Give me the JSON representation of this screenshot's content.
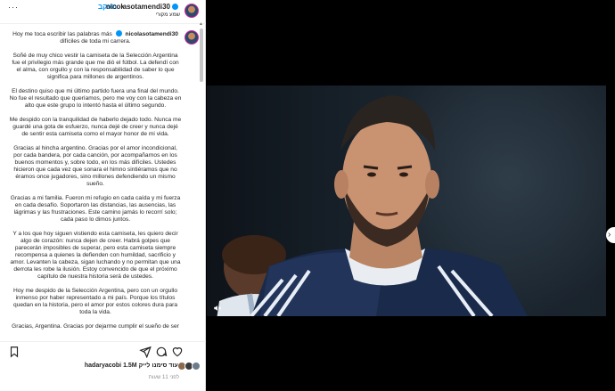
{
  "header": {
    "username": "nicolasotamendi30",
    "follow_label": "מעקב",
    "separator": "•",
    "subtitle": "שמע מקורי",
    "more": "···"
  },
  "caption": {
    "username": "nicolasotamendi30",
    "first_line": "Hoy me toca escribir las palabras más",
    "first_line_end": "difíciles de toda mi carrera.",
    "paragraphs": [
      "Soñé de muy chico vestir la camiseta de la Selección Argentina fue el privilegio más grande que me dió el fútbol. La defendí con el alma, con orgullo y con la responsabilidad de saber lo que significa para millones de argentinos.",
      "El destino quiso que mi último partido fuera una final del mundo. No fue el resultado que queríamos, pero me voy con la cabeza en alto que este grupo lo intentó hasta el último segundo.",
      "Me despido con la tranquilidad de haberlo dejado todo. Nunca me guardé una gota de esfuerzo, nunca dejé de creer y nunca dejé de sentir esta camiseta como el mayor honor de mi vida.",
      "Gracias al hincha argentino. Gracias por el amor incondicional, por cada bandera, por cada canción, por acompañarnos en los buenos momentos y, sobre todo, en los más difíciles. Ustedes hicieron que cada vez que sonara el himno sintiéramos que no éramos once jugadores, sino millones defendiendo un mismo sueño.",
      "Gracias a mi familia. Fueron mi refugio en cada caída y mi fuerza en cada desafío. Soportaron las distancias, las ausencias, las lágrimas y las frustraciones. Este camino jamás lo recorrí solo; cada paso lo dimos juntos.",
      "Y a los que hoy siguen vistiendo esta camiseta, les quiero decir algo de corazón: nunca dejen de creer. Habrá golpes que parecerán imposibles de superar, pero esta camiseta siempre recompensa a quienes la defienden con humildad, sacrificio y amor. Levanten la cabeza, sigan luchando y no permitan que una derrota les robe la ilusión. Estoy convencido de que el próximo capítulo de nuestra historia será de ustedes.",
      "Hoy me despido de la Selección Argentina, pero con un orgullo inmenso por haber representado a mi país. Porque los títulos quedan en la historia, pero el amor por estos colores dura para toda la vida.",
      "Gracias, Argentina. Gracias por dejarme cumplir el sueño de ser"
    ]
  },
  "actions": {
    "like_icon": "heart-icon",
    "comment_icon": "comment-icon",
    "share_icon": "share-icon",
    "save_icon": "bookmark-icon"
  },
  "likes": {
    "text_prefix": "hadaryacobi 1.5M",
    "text_suffix": "ועוד סימנו לייק"
  },
  "timestamp": "לפני 11 שעות",
  "video": {
    "mute_icon": "mute-icon"
  },
  "navigation": {
    "next_glyph": "›"
  },
  "colors": {
    "accent": "#0095f6",
    "text": "#262626",
    "muted": "#8e8e8e"
  }
}
